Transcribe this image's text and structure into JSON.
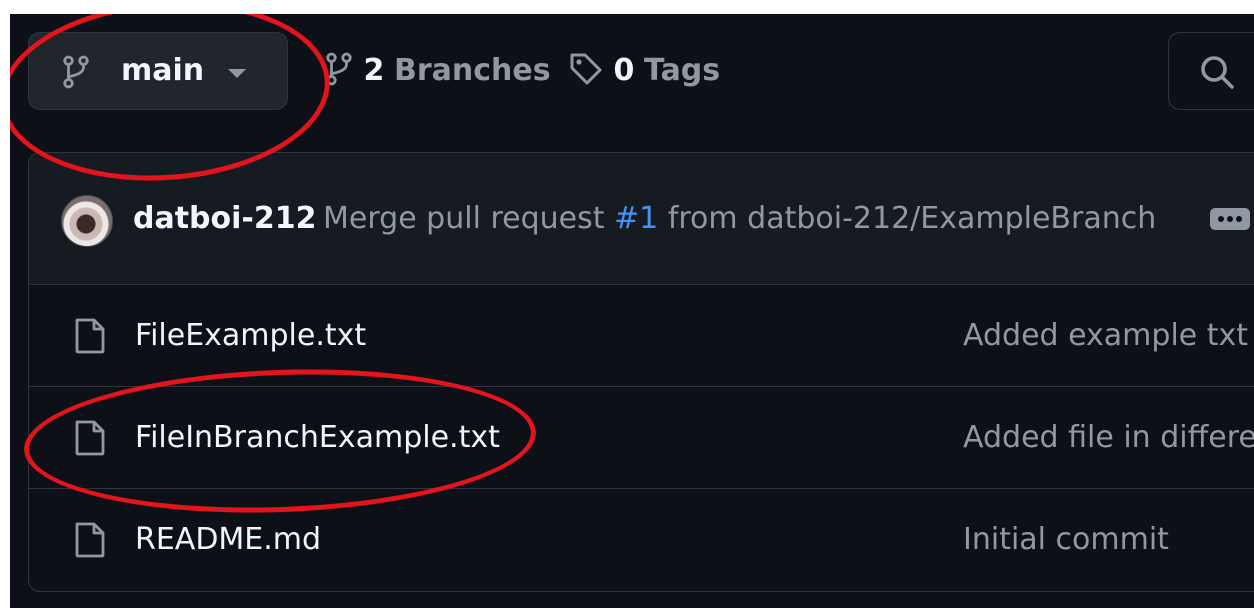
{
  "branch_selector": {
    "label": "main",
    "icon": "git-branch-icon",
    "caret_icon": "triangle-down-icon"
  },
  "branches_link": {
    "count": "2",
    "word": "Branches",
    "icon": "git-branch-icon"
  },
  "tags_link": {
    "count": "0",
    "word": "Tags",
    "icon": "tag-icon"
  },
  "search": {
    "icon": "search-icon"
  },
  "latest_commit": {
    "author": "datboi-212",
    "message_prefix": "Merge pull request",
    "pr_number": "#1",
    "message_suffix": "from datboi-212/ExampleBranch",
    "more_icon": "kebab-horizontal-icon"
  },
  "files": [
    {
      "name": "FileExample.txt",
      "commit": "Added example txt"
    },
    {
      "name": "FileInBranchExample.txt",
      "commit": "Added file in differe"
    },
    {
      "name": "README.md",
      "commit": "Initial commit"
    }
  ],
  "colors": {
    "background": "#0d1117",
    "header_bg": "#161b22",
    "border": "#30363d",
    "text_primary": "#f0f6fc",
    "text_muted": "#9198a1",
    "link": "#4493f8",
    "annotation": "#e3141b"
  }
}
